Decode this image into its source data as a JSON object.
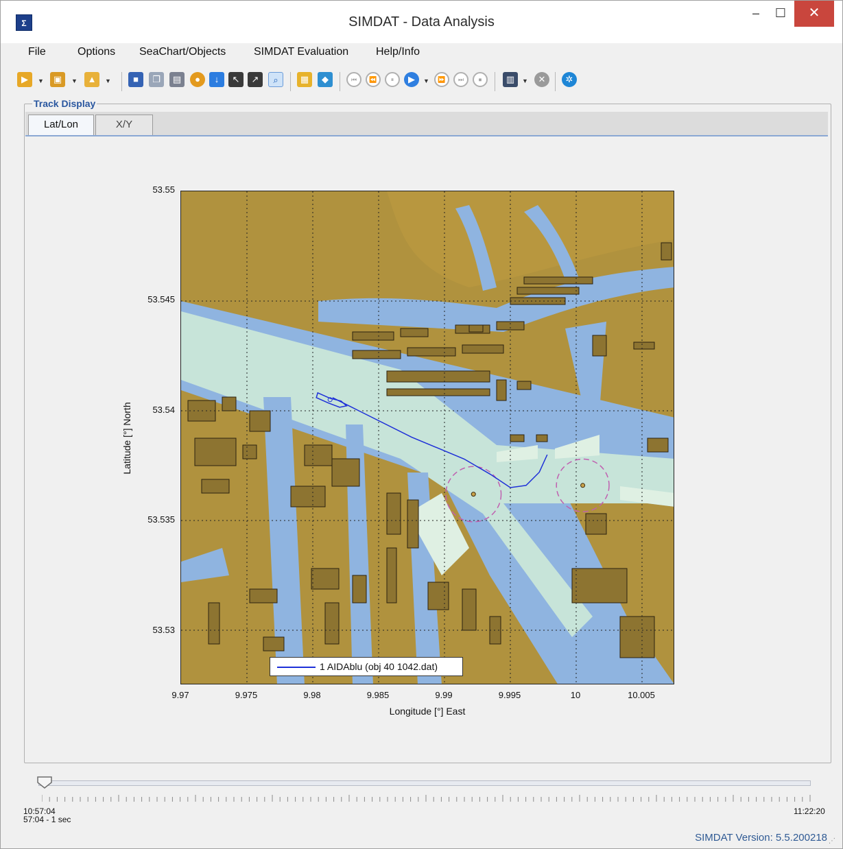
{
  "window": {
    "title": "SIMDAT - Data Analysis",
    "app_icon": "sigma-delta-icon",
    "minimize_glyph": "–",
    "maximize_glyph": "☐",
    "close_glyph": "✕"
  },
  "menu": [
    "File",
    "Options",
    "SeaChart/Objects",
    "SIMDAT Evaluation",
    "Help/Info"
  ],
  "toolbar": {
    "icons": [
      "open-folder-icon",
      "import-icon",
      "export-icon",
      "save-icon",
      "copy-icon",
      "print-icon",
      "globe-icon",
      "arrow-down-icon",
      "arrow-up-left-icon",
      "arrow-up-right-icon",
      "zoom-icon",
      "report-icon",
      "book-icon",
      "skip-start-icon",
      "rewind-icon",
      "pause-icon",
      "play-icon",
      "fast-forward-icon",
      "skip-end-icon",
      "stop-icon",
      "film-icon",
      "cancel-icon",
      "settings-icon"
    ]
  },
  "group_title": "Track Display",
  "tabs": [
    {
      "label": "Lat/Lon",
      "active": true
    },
    {
      "label": "X/Y",
      "active": false
    }
  ],
  "chart_data": {
    "type": "line",
    "title": "",
    "xlabel": "Longitude [°] East",
    "ylabel": "Latitude [°] North",
    "xlim": [
      9.97,
      10.0075
    ],
    "ylim": [
      53.5275,
      53.55
    ],
    "x_ticks": [
      "9.97",
      "9.975",
      "9.98",
      "9.985",
      "9.99",
      "9.995",
      "10",
      "10.005"
    ],
    "y_ticks": [
      "53.55",
      "53.545",
      "53.54",
      "53.535",
      "53.53"
    ],
    "grid": true,
    "legend_position": "bottom-center",
    "background": "sea chart",
    "series": [
      {
        "name": "1 AIDAblu (obj 40 1042.dat)",
        "color": "#1d2fd8",
        "x": [
          9.9815,
          9.9835,
          9.9875,
          9.9915,
          9.9935,
          9.995,
          9.9962,
          9.9972,
          9.9978
        ],
        "y": [
          53.5406,
          53.54,
          53.5388,
          53.5378,
          53.5371,
          53.5365,
          53.5366,
          53.5372,
          53.538
        ]
      }
    ],
    "annotations": [
      {
        "type": "ship-outline",
        "x": 9.981,
        "y": 53.5406
      },
      {
        "type": "turning-circle",
        "x": 9.9922,
        "y": 53.5362,
        "radius_deg": 0.0021
      },
      {
        "type": "turning-circle",
        "x": 10.0005,
        "y": 53.5366,
        "radius_deg": 0.002
      }
    ]
  },
  "timeline": {
    "start": "10:57:04",
    "end": "11:22:20",
    "step": "57:04 - 1 sec",
    "progress": 0.0
  },
  "status": {
    "version": "SIMDAT Version: 5.5.200218"
  },
  "colors": {
    "land": "#b0923e",
    "built": "#8d7431",
    "shallow": "#8fb4e0",
    "channel": "#c7e4d9",
    "turning_circle": "#c060b0"
  }
}
